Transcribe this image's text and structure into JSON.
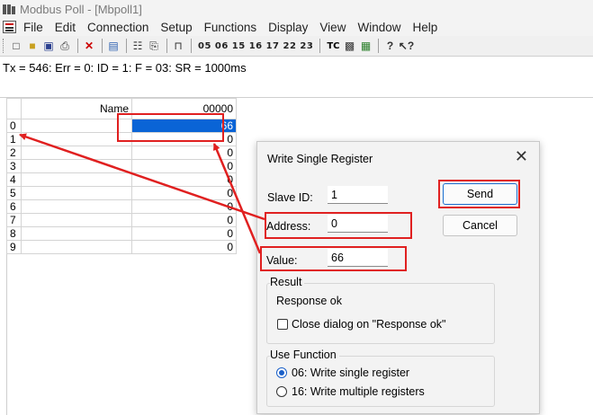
{
  "window": {
    "title": "Modbus Poll - [Mbpoll1]"
  },
  "menu": [
    "File",
    "Edit",
    "Connection",
    "Setup",
    "Functions",
    "Display",
    "View",
    "Window",
    "Help"
  ],
  "toolbar": {
    "function_codes": "05 06 15 16 17 22 23",
    "tc_label": "TC"
  },
  "status": {
    "text": "Tx = 546: Err = 0: ID = 1: F = 03: SR = 1000ms"
  },
  "grid": {
    "name_header": "Name",
    "value_header": "00000",
    "rows": [
      {
        "index": "0",
        "name": "",
        "value": "66",
        "selected": true
      },
      {
        "index": "1",
        "name": "",
        "value": "0"
      },
      {
        "index": "2",
        "name": "",
        "value": "0"
      },
      {
        "index": "3",
        "name": "",
        "value": "0"
      },
      {
        "index": "4",
        "name": "",
        "value": "0"
      },
      {
        "index": "5",
        "name": "",
        "value": "0"
      },
      {
        "index": "6",
        "name": "",
        "value": "0"
      },
      {
        "index": "7",
        "name": "",
        "value": "0"
      },
      {
        "index": "8",
        "name": "",
        "value": "0"
      },
      {
        "index": "9",
        "name": "",
        "value": "0"
      }
    ]
  },
  "dialog": {
    "title": "Write Single Register",
    "close_icon": "close-icon",
    "slave_id_label": "Slave ID:",
    "slave_id_value": "1",
    "address_label": "Address:",
    "address_value": "0",
    "value_label": "Value:",
    "value_value": "66",
    "send_label": "Send",
    "cancel_label": "Cancel",
    "result_title": "Result",
    "result_text": "Response ok",
    "close_on_ok_label": "Close dialog on \"Response ok\"",
    "close_on_ok_checked": false,
    "use_function_title": "Use Function",
    "fn06_label": "06: Write single register",
    "fn16_label": "16: Write multiple registers",
    "selected_function": "06"
  },
  "colors": {
    "selection": "#0a64d6",
    "annotation": "#e02020",
    "radio_accent": "#1a5fc8"
  }
}
